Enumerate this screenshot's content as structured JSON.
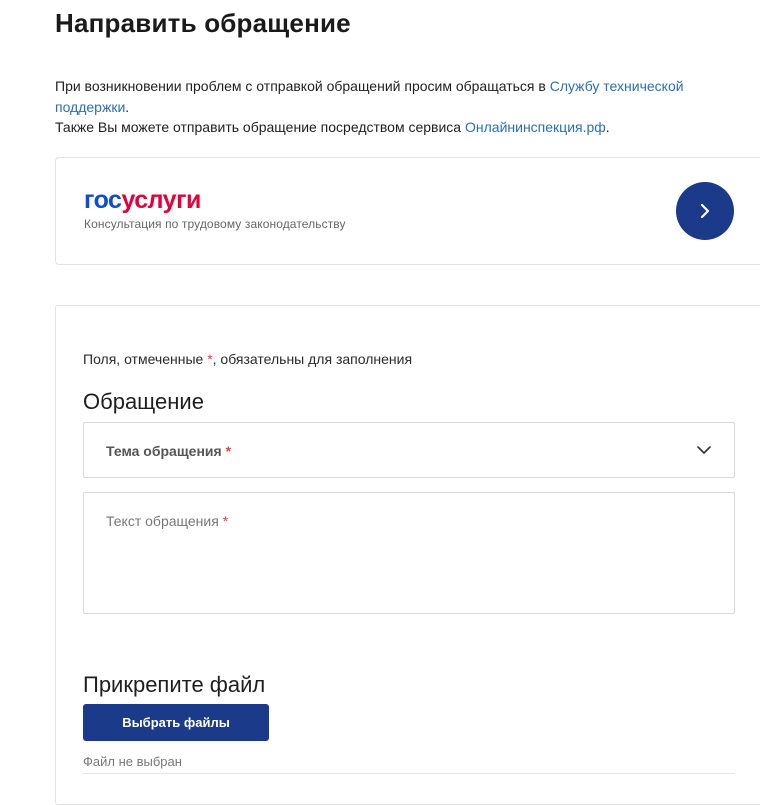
{
  "page": {
    "title": "Направить обращение"
  },
  "info": {
    "line1_prefix": "При возникновении проблем с отправкой обращений просим обращаться в ",
    "support_link": "Службу технической поддержки",
    "line1_suffix": ".",
    "line2_prefix": "Также Вы можете отправить обращение посредством сервиса ",
    "inspection_link": "Онлайнинспекция.рф",
    "line2_suffix": "."
  },
  "gosuslugi": {
    "logo_part1": "гос",
    "logo_part2": "услуги",
    "subtitle": "Консультация по трудовому законодательству",
    "arrow_icon": "chevron-right-icon",
    "colors": {
      "logo_blue": "#0d4cd3",
      "logo_red": "#e4003a",
      "button": "#1b3a8a"
    }
  },
  "form": {
    "required_note_prefix": "Поля, отмеченные ",
    "required_mark": "*",
    "required_note_suffix": ", обязательны для заполнения",
    "section_title": "Обращение",
    "topic_label": "Тема обращения",
    "topic_icon": "chevron-down-icon",
    "text_label": "Текст обращения",
    "attach_title": "Прикрепите файл",
    "choose_files_button": "Выбрать файлы",
    "file_status": "Файл не выбран"
  }
}
